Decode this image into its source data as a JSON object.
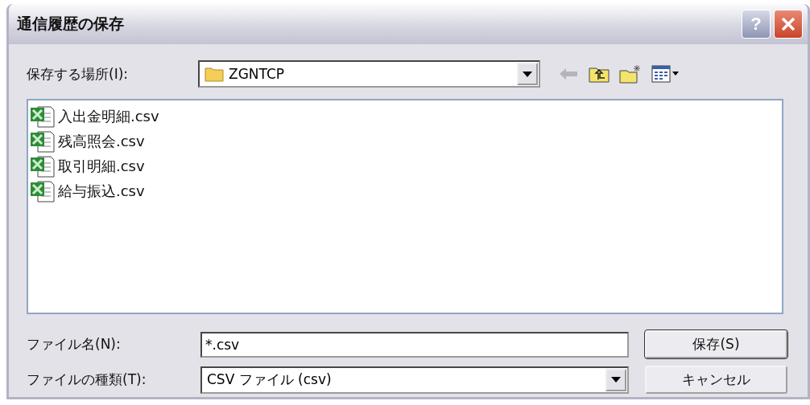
{
  "window": {
    "title": "通信履歴の保存",
    "buttons": [
      "?"
    ]
  },
  "location": {
    "label": "保存する場所(I):",
    "value": "ZGNTCP"
  },
  "files": [
    {
      "name": "入出金明細.csv"
    },
    {
      "name": "残高照会.csv"
    },
    {
      "name": "取引明細.csv"
    },
    {
      "name": "給与振込.csv"
    }
  ],
  "filename": {
    "label": "ファイル名(N):",
    "value": "*.csv"
  },
  "filetype": {
    "label": "ファイルの種類(T):",
    "value": "CSV ファイル (csv)"
  },
  "buttons": [
    "保存(S)",
    "キャンセル"
  ]
}
